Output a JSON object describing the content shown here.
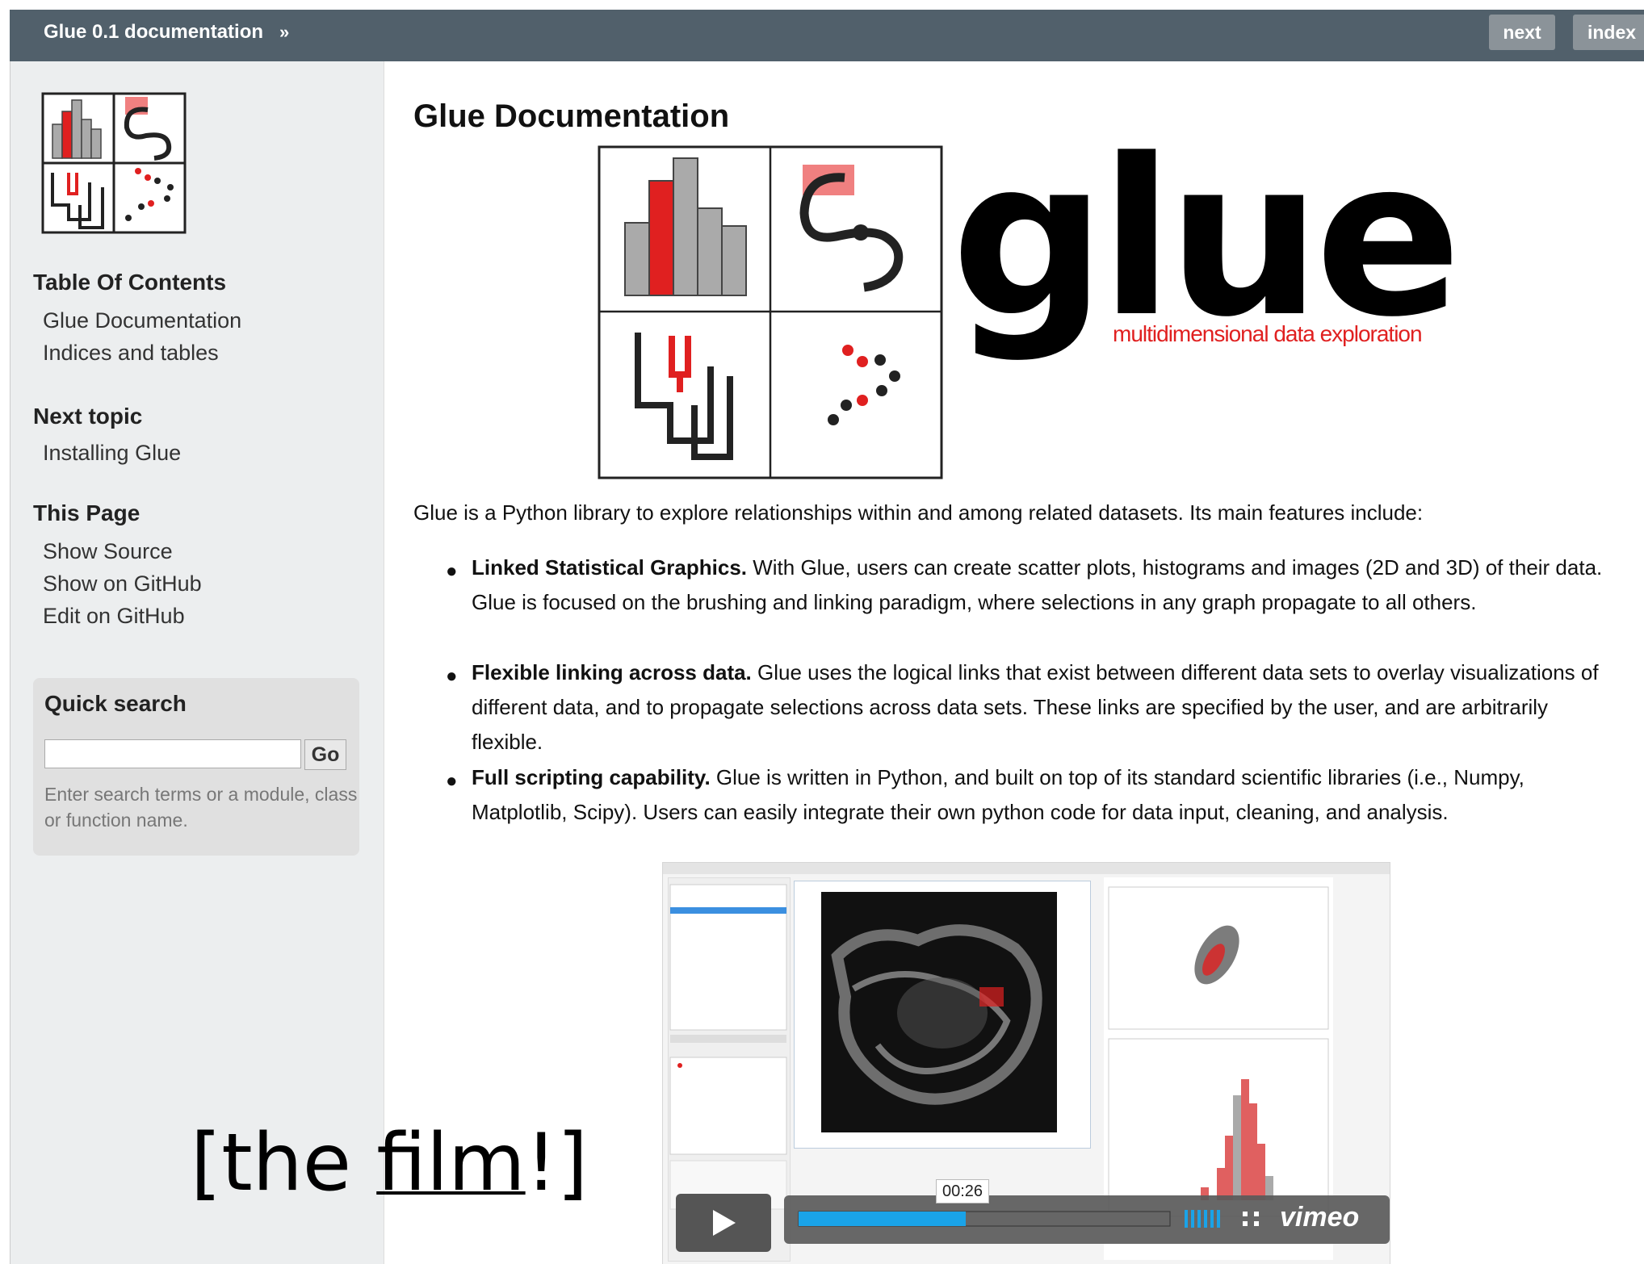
{
  "topbar": {
    "breadcrumb": "Glue 0.1 documentation",
    "breadcrumb_sep": "»",
    "next_label": "next",
    "index_label": "index"
  },
  "sidebar": {
    "toc_title": "Table Of Contents",
    "toc_items": [
      "Glue Documentation",
      "Indices and tables"
    ],
    "next_topic_title": "Next topic",
    "next_topic_link": "Installing Glue",
    "this_page_title": "This Page",
    "this_page_links": [
      "Show Source",
      "Show on GitHub",
      "Edit on GitHub"
    ],
    "quick_search": {
      "title": "Quick search",
      "input_value": "",
      "go_label": "Go",
      "hint": "Enter search terms or a module, class or function name."
    }
  },
  "main": {
    "title": "Glue Documentation",
    "logo_word": "glue",
    "logo_tagline": "multidimensional data exploration",
    "intro": "Glue is a Python library to explore relationships within and among related datasets. Its main features include:",
    "features": [
      {
        "bold": "Linked Statistical Graphics.",
        "text": " With Glue, users can create scatter plots, histograms and images (2D and 3D) of their data. Glue is focused on the brushing and linking paradigm, where selections in any graph propagate to all others."
      },
      {
        "bold": "Flexible linking across data.",
        "text": " Glue uses the logical links that exist between different data sets to overlay visualizations of different data, and to propagate selections across data sets. These links are specified by the user, and are arbitrarily flexible."
      },
      {
        "bold": "Full scripting capability.",
        "text": " Glue is written in Python, and built on top of its standard scientific libraries (i.e., Numpy, Matplotlib, Scipy). Users can easily integrate their own python code for data input, cleaning, and analysis."
      }
    ],
    "video": {
      "time": "00:26",
      "progress": 0.45,
      "brand": "vimeo"
    }
  },
  "caption": {
    "open": "[the ",
    "link": "film",
    "close": "!]"
  },
  "colors": {
    "topbar": "#51606b",
    "sidebar_bg": "#eceeef",
    "accent_red": "#e02020",
    "progress_blue": "#1aa3e8"
  }
}
